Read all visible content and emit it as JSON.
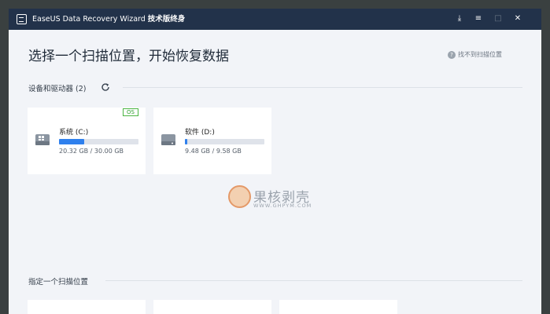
{
  "window": {
    "app_title": "EaseUS Data Recovery Wizard",
    "edition": "技术版终身"
  },
  "titlebar_buttons": [
    {
      "name": "download-icon",
      "glyph": "⤓"
    },
    {
      "name": "menu-icon",
      "glyph": "≡"
    },
    {
      "name": "maximize-icon",
      "glyph": "□"
    },
    {
      "name": "close-icon",
      "glyph": "✕"
    }
  ],
  "main": {
    "heading": "选择一个扫描位置，开始恢复数据",
    "help_link": "找不到扫描位置"
  },
  "devices": {
    "title": "设备和驱动器 (2)",
    "drives": [
      {
        "name": "系统 (C:)",
        "size": "20.32 GB / 30.00 GB",
        "used_fraction": 0.32,
        "badge": "OS"
      },
      {
        "name": "软件 (D:)",
        "size": "9.48 GB / 9.58 GB",
        "used_fraction": 0.03,
        "badge": ""
      }
    ]
  },
  "watermark": {
    "cn": "果核剥壳",
    "en": "WWW.GHPYM.COM"
  },
  "locations": {
    "title": "指定一个扫描位置"
  },
  "colors": {
    "titlebar": "#22324a",
    "accent": "#2f80ed",
    "os_badge": "#4bb543"
  }
}
